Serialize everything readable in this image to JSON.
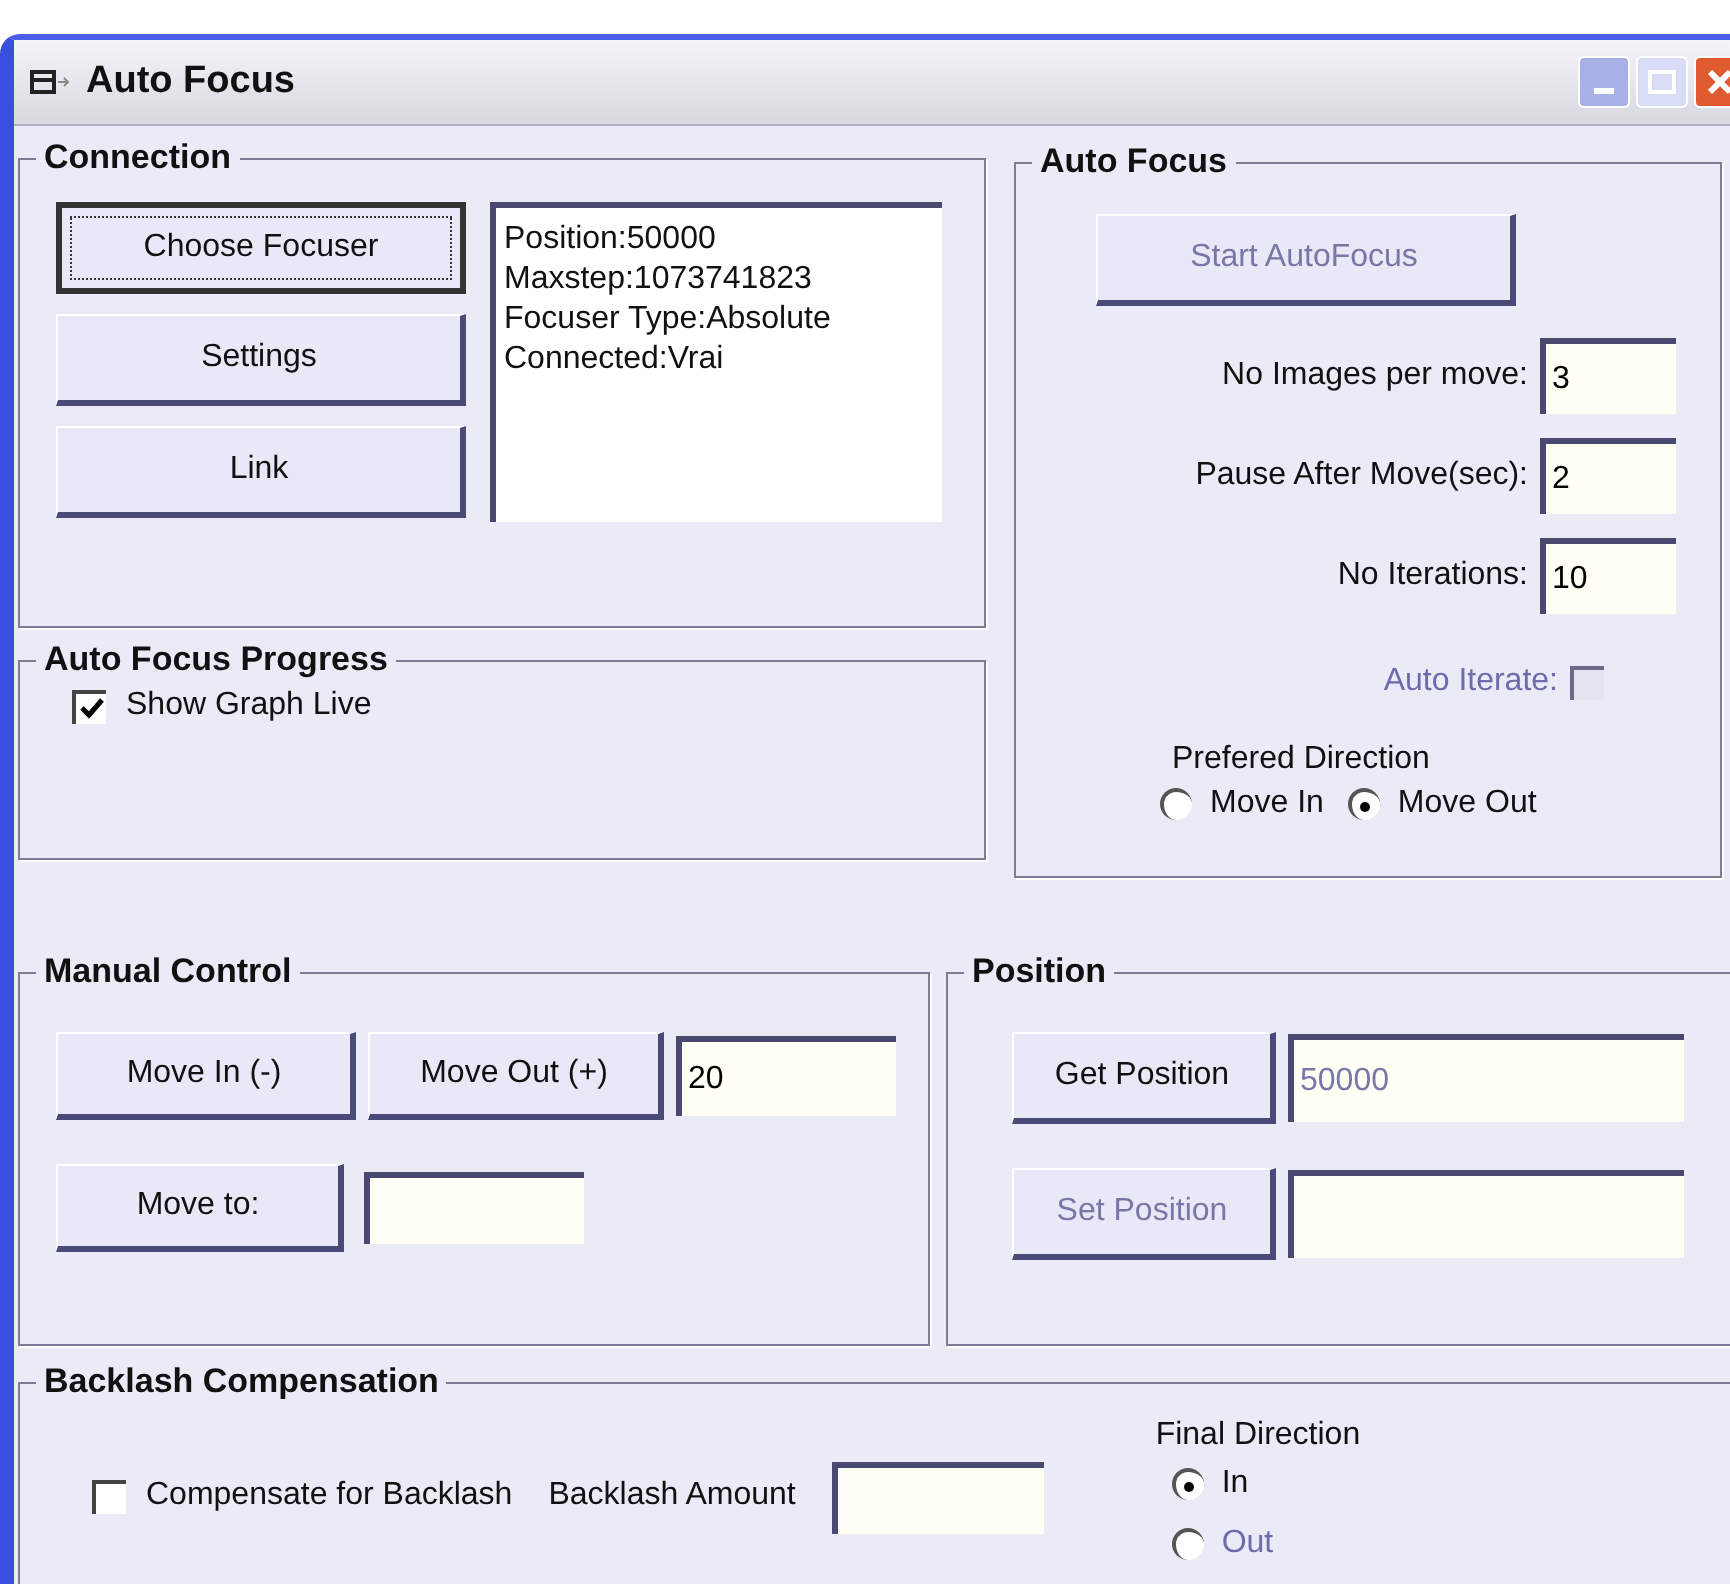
{
  "window": {
    "title": "Auto Focus"
  },
  "connection": {
    "title": "Connection",
    "buttons": [
      {
        "label": "Choose Focuser",
        "focused": true
      },
      {
        "label": "Settings",
        "focused": false
      },
      {
        "label": "Link",
        "focused": false
      }
    ],
    "info_lines": [
      "Position:50000",
      "Maxstep:1073741823",
      "Focuser Type:Absolute",
      "Connected:Vrai"
    ]
  },
  "progress": {
    "title": "Auto Focus Progress",
    "show_graph": {
      "label": "Show Graph Live",
      "checked": true
    }
  },
  "auto_focus": {
    "title": "Auto Focus",
    "start_button": {
      "label": "Start AutoFocus",
      "disabled": true
    },
    "fields": [
      {
        "label": "No Images per move:",
        "value": "3"
      },
      {
        "label": "Pause After Move(sec):",
        "value": "2"
      },
      {
        "label": "No Iterations:",
        "value": "10"
      }
    ],
    "auto_iterate": {
      "label": "Auto Iterate:",
      "checked": false,
      "disabled": true
    },
    "direction": {
      "label": "Prefered Direction",
      "options": [
        {
          "label": "Move In",
          "selected": false
        },
        {
          "label": "Move Out",
          "selected": true
        }
      ]
    }
  },
  "manual": {
    "title": "Manual Control",
    "move_in": {
      "label": "Move In (-)"
    },
    "move_out": {
      "label": "Move Out (+)"
    },
    "step": {
      "value": "20"
    },
    "move_to": {
      "label": "Move to:"
    }
  },
  "position": {
    "title": "Position",
    "get_button": {
      "label": "Get Position",
      "disabled": false
    },
    "value": {
      "value": "50000",
      "disabled": true
    },
    "set_button": {
      "label": "Set Position",
      "disabled": true
    }
  },
  "backlash": {
    "title": "Backlash Compensation",
    "compensate": {
      "label": "Compensate for Backlash",
      "checked": false
    },
    "amount_label": "Backlash Amount",
    "final_direction": {
      "label": "Final Direction",
      "options": [
        {
          "label": "In",
          "selected": true,
          "disabled": false
        },
        {
          "label": "Out",
          "selected": false,
          "disabled": true
        }
      ]
    }
  }
}
